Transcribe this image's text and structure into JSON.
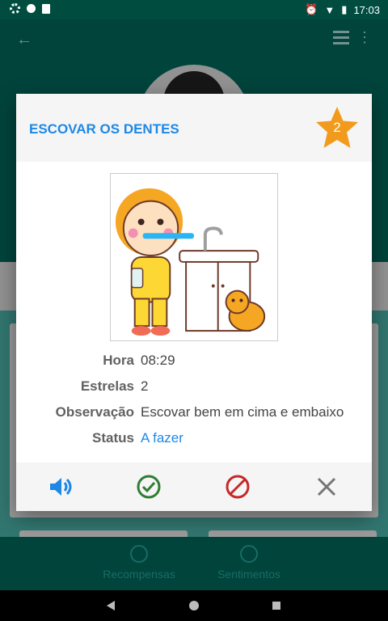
{
  "status_bar": {
    "time": "17:03"
  },
  "dialog": {
    "title": "ESCOVAR OS DENTES",
    "stars_badge": "2",
    "fields": [
      {
        "label": "Hora",
        "value": "08:29"
      },
      {
        "label": "Estrelas",
        "value": "2"
      },
      {
        "label": "Observação",
        "value": "Escovar bem em cima e embaixo"
      },
      {
        "label": "Status",
        "value": "A fazer"
      }
    ],
    "actions": [
      "speaker-icon",
      "check-circle-icon",
      "block-icon",
      "close-icon"
    ]
  },
  "bottom_nav": {
    "items": [
      {
        "label": "Recompensas",
        "icon": "medal-icon"
      },
      {
        "label": "Sentimentos",
        "icon": "smiley-icon"
      }
    ]
  },
  "colors": {
    "primary": "#00695c",
    "accent_blue": "#1e88e5",
    "star_orange": "#f29a1b",
    "check_green": "#2e7d32",
    "block_red": "#c62828"
  }
}
